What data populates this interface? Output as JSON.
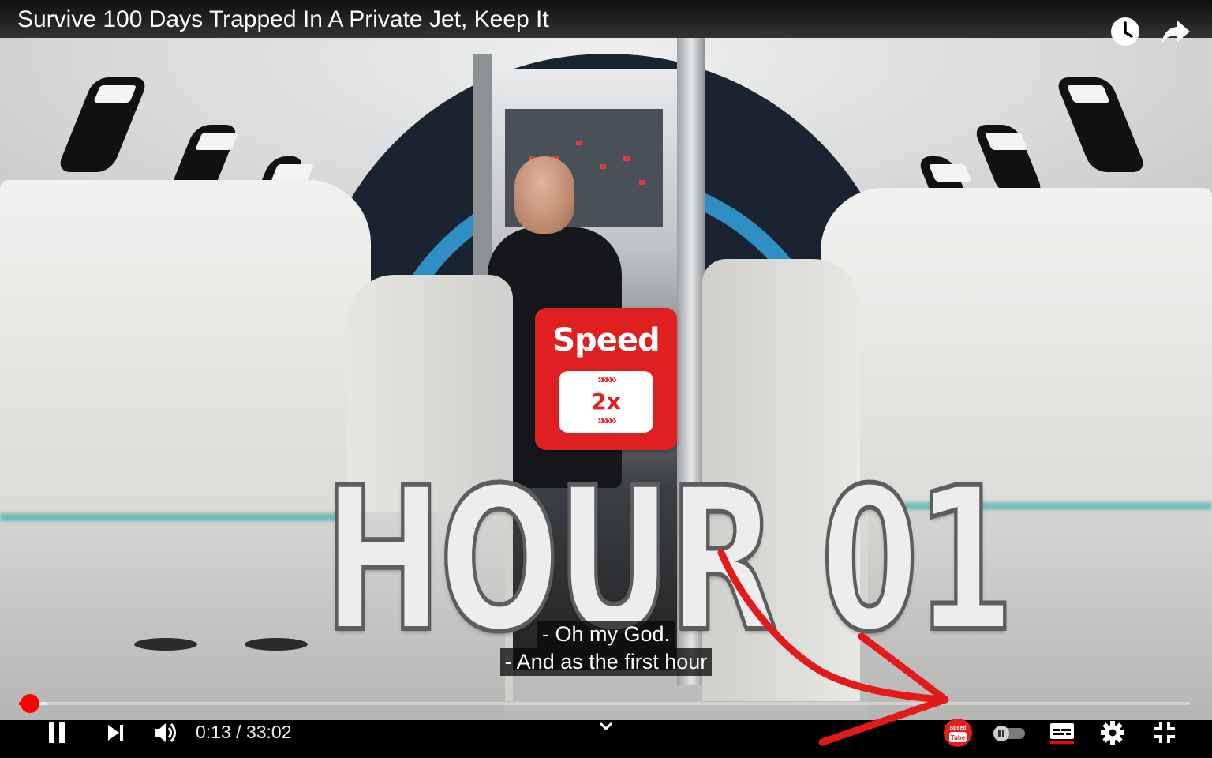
{
  "video": {
    "title": "Survive 100 Days Trapped In A Private Jet, Keep It"
  },
  "overlay": {
    "speed_badge_label": "Speed",
    "speed_badge_multiplier": "2x",
    "speed_badge_chevrons": "»»»»",
    "hour_text": "HOUR 01"
  },
  "captions": [
    "- Oh my God.",
    "- And as the first hour"
  ],
  "player": {
    "current_time": "0:13",
    "separator": " / ",
    "duration": "33:02",
    "progress_fraction": 0.0066,
    "buffered_fraction": 0.024
  },
  "icons": {
    "top": [
      "watch-later-icon",
      "share-icon"
    ],
    "controls": [
      "pause-icon",
      "next-icon",
      "volume-icon",
      "chevron-down-icon",
      "speedtube-extension-icon",
      "autoplay-toggle",
      "subtitles-icon",
      "settings-icon",
      "exit-fullscreen-icon"
    ]
  },
  "extension": {
    "badge_line1": "Speed",
    "badge_line2": "Tube"
  },
  "colors": {
    "accent": "#ff0000",
    "speed_badge": "#e02020",
    "annotation_arrow": "#e21a1a"
  }
}
